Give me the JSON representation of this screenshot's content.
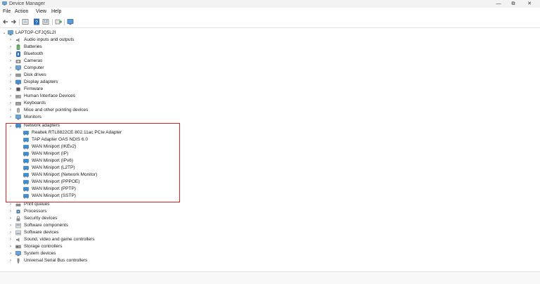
{
  "window": {
    "title": "Device Manager",
    "minimize": "—",
    "maximize": "⧉",
    "close": "✕"
  },
  "menu": [
    "File",
    "Action",
    "View",
    "Help"
  ],
  "toolbar": {
    "icons": [
      "back-arrow-icon",
      "forward-arrow-icon",
      "properties-icon",
      "help-icon",
      "device-view-icon",
      "update-driver-icon",
      "scan-hardware-icon"
    ]
  },
  "tree": {
    "root": "LAPTOP-CFJQ5L2I",
    "categories_top": [
      "Audio inputs and outputs",
      "Batteries",
      "Bluetooth",
      "Cameras",
      "Computer",
      "Disk drives",
      "Display adapters",
      "Firmware",
      "Human Interface Devices",
      "Keyboards",
      "Mice and other pointing devices",
      "Monitors"
    ],
    "expanded": {
      "label": "Network adapters",
      "children": [
        "Realtek RTL8822CE 802.11ac PCIe Adapter",
        "TAP Adapter OAS NDIS 6.0",
        "WAN Miniport (IKEv2)",
        "WAN Miniport (IP)",
        "WAN Miniport (IPv6)",
        "WAN Miniport (L2TP)",
        "WAN Miniport (Network Monitor)",
        "WAN Miniport (PPPOE)",
        "WAN Miniport (PPTP)",
        "WAN Miniport (SSTP)"
      ]
    },
    "categories_bottom": [
      "Print queues",
      "Processors",
      "Security devices",
      "Software components",
      "Software devices",
      "Sound, video and game controllers",
      "Storage controllers",
      "System devices",
      "Universal Serial Bus controllers"
    ]
  },
  "colors": {
    "highlight": "#d6252b",
    "network_icon": "#3a8fd6"
  }
}
